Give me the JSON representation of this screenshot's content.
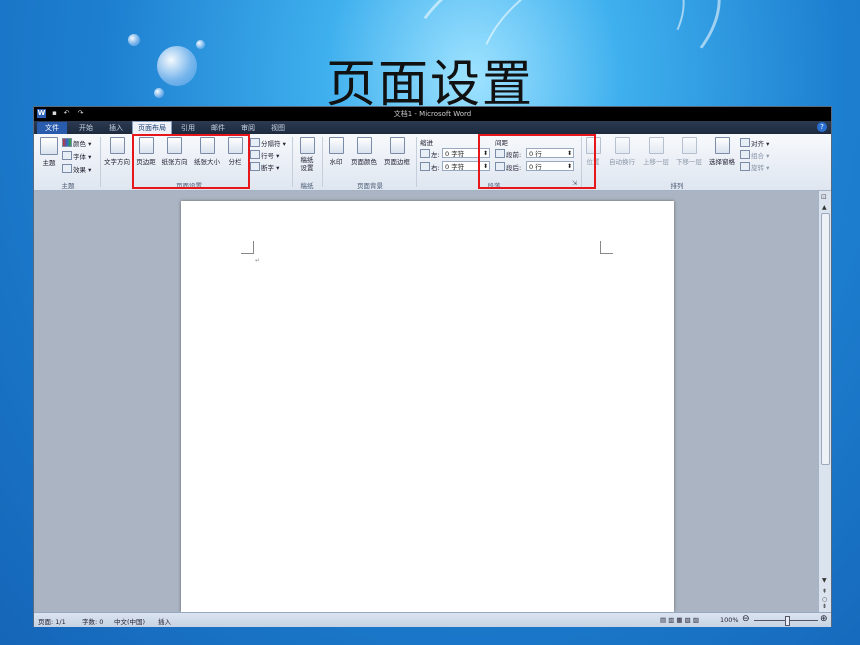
{
  "slide": {
    "title": "页面设置"
  },
  "window": {
    "title": "文档1 - Microsoft Word",
    "logo": "W",
    "quick_access": [
      "save-icon",
      "undo-icon",
      "redo-icon"
    ]
  },
  "tabs": [
    {
      "label": "文件",
      "state": "file"
    },
    {
      "label": "开始"
    },
    {
      "label": "插入"
    },
    {
      "label": "页面布局",
      "state": "active"
    },
    {
      "label": "引用"
    },
    {
      "label": "邮件"
    },
    {
      "label": "审阅"
    },
    {
      "label": "视图"
    }
  ],
  "ribbon": {
    "themes": {
      "theme": "主题",
      "colors": "颜色",
      "fonts": "字体",
      "effects": "效果",
      "group": "主题"
    },
    "page_setup": {
      "text_direction": "文字方向",
      "margins": "页边距",
      "orientation": "纸张方向",
      "size": "纸张大小",
      "columns": "分栏",
      "breaks": "分隔符",
      "line_numbers": "行号",
      "hyphenation": "断字",
      "group": "页面设置"
    },
    "draft": {
      "label": "稿纸设置",
      "group": "稿纸"
    },
    "page_background": {
      "watermark": "水印",
      "page_color": "页面颜色",
      "page_borders": "页面边框",
      "group": "页面背景"
    },
    "paragraph": {
      "indent_title": "缩进",
      "indent_left_label": "左:",
      "indent_left_value": "0 字符",
      "indent_right_label": "右:",
      "indent_right_value": "0 字符",
      "spacing_title": "间距",
      "spacing_before_label": "段前:",
      "spacing_before_value": "0 行",
      "spacing_after_label": "段后:",
      "spacing_after_value": "0 行",
      "group": "段落"
    },
    "arrange": {
      "position": "位置",
      "wrap": "自动换行",
      "bring_forward": "上移一层",
      "send_backward": "下移一层",
      "selection_pane": "选择窗格",
      "align": "对齐",
      "group_obj": "组合",
      "rotate": "旋转",
      "group": "排列"
    }
  },
  "status": {
    "page": "页面: 1/1",
    "words": "字数: 0",
    "language": "中文(中国)",
    "mode": "插入",
    "zoom": "100%"
  },
  "colors": {
    "accent_red": "#e6161b",
    "file_tab": "#2a5cae"
  }
}
